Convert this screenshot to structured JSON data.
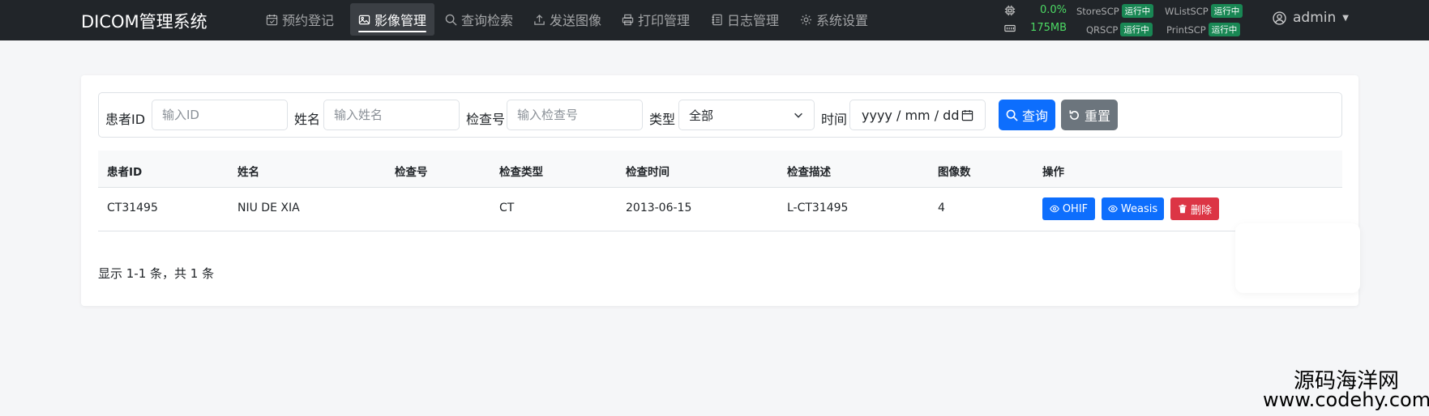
{
  "brand": "DICOM管理系统",
  "nav": [
    {
      "label": "预约登记",
      "icon": "calendar-check-icon"
    },
    {
      "label": "影像管理",
      "icon": "image-icon",
      "active": true
    },
    {
      "label": "查询检索",
      "icon": "search-icon"
    },
    {
      "label": "发送图像",
      "icon": "upload-icon"
    },
    {
      "label": "打印管理",
      "icon": "printer-icon"
    },
    {
      "label": "日志管理",
      "icon": "journal-icon"
    },
    {
      "label": "系统设置",
      "icon": "gear-icon"
    }
  ],
  "system": {
    "cpu": "0.0%",
    "memory": "175MB",
    "services": [
      {
        "name": "StoreSCP",
        "status": "运行中"
      },
      {
        "name": "WListSCP",
        "status": "运行中"
      },
      {
        "name": "QRSCP",
        "status": "运行中"
      },
      {
        "name": "PrintSCP",
        "status": "运行中"
      }
    ],
    "status_color": "#198754",
    "value_color": "#4cd964"
  },
  "user": {
    "name": "admin"
  },
  "filter": {
    "patient_id_label": "患者ID",
    "patient_id_placeholder": "输入ID",
    "name_label": "姓名",
    "name_placeholder": "输入姓名",
    "exam_no_label": "检查号",
    "exam_no_placeholder": "输入检查号",
    "type_label": "类型",
    "type_value": "全部",
    "time_label": "时间",
    "date_placeholder": "yyyy / mm / dd",
    "search_button": "查询",
    "reset_button": "重置"
  },
  "table": {
    "headers": [
      "患者ID",
      "姓名",
      "检查号",
      "检查类型",
      "检查时间",
      "检查描述",
      "图像数",
      "操作"
    ],
    "rows": [
      {
        "patient_id": "CT31495",
        "name": "NIU DE XIA",
        "exam_no": "",
        "exam_type": "CT",
        "exam_time": "2013-06-15",
        "description": "L-CT31495",
        "image_count": "4",
        "actions": [
          "OHIF",
          "Weasis",
          "删除"
        ]
      }
    ]
  },
  "summary": "显示 1-1 条，共 1 条",
  "watermark": {
    "line1": "源码海洋网",
    "line2": "www.codehy.com"
  },
  "colors": {
    "primary": "#0d6efd",
    "secondary": "#6c757d",
    "danger": "#dc3545",
    "navbar": "#212529"
  }
}
